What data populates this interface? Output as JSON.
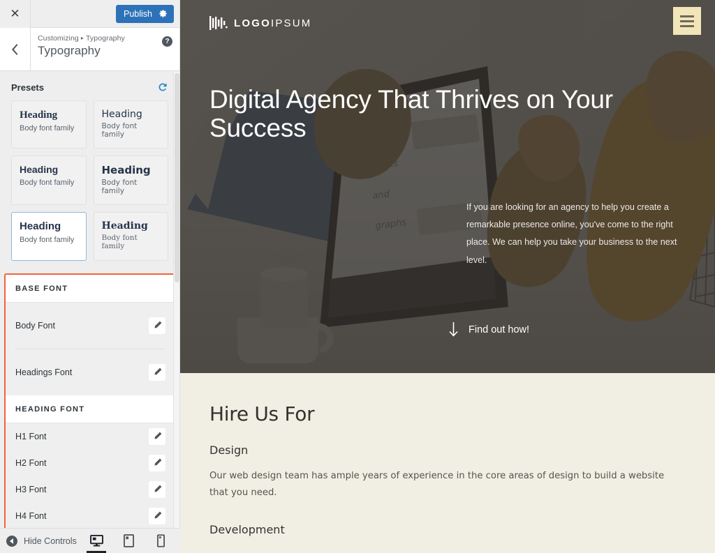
{
  "sidebar": {
    "topbar": {
      "close_label": "✕",
      "publish_label": "Publish",
      "gear_icon": "gear-icon"
    },
    "header": {
      "back_icon": "chevron-left-icon",
      "breadcrumb_root": "Customizing",
      "breadcrumb_separator": "▸",
      "breadcrumb_current": "Typography",
      "panel_title": "Typography",
      "help_label": "?"
    },
    "presets": {
      "title": "Presets",
      "reset_icon": "reset-icon",
      "items": [
        {
          "heading": "Heading",
          "body": "Body font family",
          "style": "f-serif",
          "selected": false
        },
        {
          "heading": "Heading",
          "body": "Body font family",
          "style": "f-sans",
          "selected": false
        },
        {
          "heading": "Heading",
          "body": "Body font family",
          "style": "f-bold",
          "selected": false
        },
        {
          "heading": "Heading",
          "body": "Body font family",
          "style": "f-wide",
          "selected": false
        },
        {
          "heading": "Heading",
          "body": "Body font family",
          "style": "f-heavy",
          "selected": true
        },
        {
          "heading": "Heading",
          "body": "Body font family",
          "style": "f-serif2",
          "selected": false
        }
      ]
    },
    "base_font": {
      "section_title": "BASE FONT",
      "rows": [
        {
          "label": "Body Font",
          "edit_icon": "pencil-icon"
        },
        {
          "label": "Headings Font",
          "edit_icon": "pencil-icon"
        }
      ]
    },
    "heading_font": {
      "section_title": "HEADING FONT",
      "rows": [
        {
          "label": "H1 Font",
          "edit_icon": "pencil-icon"
        },
        {
          "label": "H2 Font",
          "edit_icon": "pencil-icon"
        },
        {
          "label": "H3 Font",
          "edit_icon": "pencil-icon"
        },
        {
          "label": "H4 Font",
          "edit_icon": "pencil-icon"
        }
      ]
    },
    "bottom": {
      "hide_controls_label": "Hide Controls",
      "devices": [
        {
          "name": "desktop",
          "icon": "desktop-icon",
          "active": true
        },
        {
          "name": "tablet",
          "icon": "tablet-icon",
          "active": false
        },
        {
          "name": "mobile",
          "icon": "mobile-icon",
          "active": false
        }
      ]
    },
    "highlight_color": "#f0633c",
    "accent_color": "#2d72b8"
  },
  "preview": {
    "logo": {
      "bold_part": "LOGO",
      "light_part": "IPSUM",
      "mark_icon": "bars-logo-icon"
    },
    "menu_icon": "hamburger-menu-icon",
    "menu_color": "#f2e5b8",
    "hero": {
      "title": "Digital Agency That Thrives on Your Success",
      "paragraph": "If you are looking for an agency to help you create a remarkable presence online, you've come to the right place. We can help you take your business to the next level.",
      "cta_label": "Find out how!",
      "cta_icon": "arrow-down-icon"
    },
    "content": {
      "title": "Hire Us For",
      "blocks": [
        {
          "heading": "Design",
          "text": "Our web design team has ample years of experience in the core areas of design to build a website that you need."
        },
        {
          "heading": "Development",
          "text": ""
        }
      ],
      "background_color": "#f1efe4"
    }
  }
}
